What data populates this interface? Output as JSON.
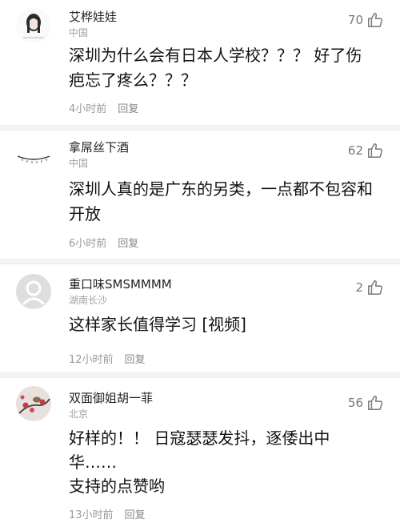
{
  "comments": [
    {
      "name": "艾桦娃娃",
      "location": "中国",
      "likes": "70",
      "text": "深圳为什么会有日本人学校？？？ 好了伤疤忘了疼么？？？",
      "time": "4小时前",
      "reply": "回复",
      "avatar_icon": "anime-girl-avatar-icon"
    },
    {
      "name": "拿屌丝下酒",
      "location": "中国",
      "likes": "62",
      "text": "深圳人真的是广东的另类，一点都不包容和开放",
      "time": "6小时前",
      "reply": "回复",
      "avatar_icon": "sketch-line-avatar-icon"
    },
    {
      "name": "重口味SMSMMMM",
      "location": "湖南长沙",
      "likes": "2",
      "text": "这样家长值得学习 [视频]",
      "time": "12小时前",
      "reply": "回复",
      "avatar_icon": "default-user-avatar-icon"
    },
    {
      "name": "双面御姐胡一菲",
      "location": "北京",
      "likes": "56",
      "text_lines": [
        "好样的！！  日寇瑟瑟发抖，逐倭出中",
        "华……",
        "支持的点赞哟"
      ],
      "time": "13小时前",
      "reply": "回复",
      "avatar_icon": "plum-blossom-bird-avatar-icon"
    }
  ],
  "icons": {
    "like": "thumbs-up-icon"
  },
  "colors": {
    "name": "#222222",
    "secondary": "#999999",
    "text": "#111111",
    "separator": "#f4f4f4"
  }
}
